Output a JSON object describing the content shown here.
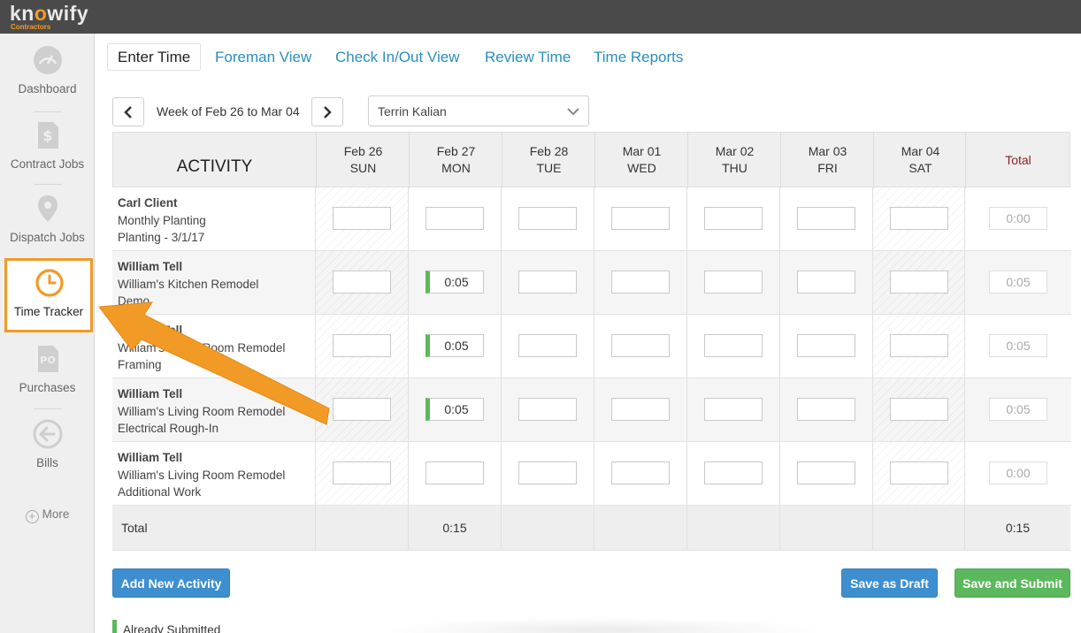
{
  "app": {
    "logo": "knowify",
    "logo_sub": "Contractors"
  },
  "sidebar": {
    "items": [
      {
        "label": "Dashboard",
        "icon": "gauge-icon"
      },
      {
        "label": "Contract Jobs",
        "icon": "dollar-document-icon"
      },
      {
        "label": "Dispatch Jobs",
        "icon": "map-pin-icon"
      },
      {
        "label": "Time Tracker",
        "icon": "clock-icon",
        "active": true
      },
      {
        "label": "Purchases",
        "icon": "po-document-icon"
      },
      {
        "label": "Bills",
        "icon": "arrow-left-circle-icon"
      }
    ],
    "more": "More"
  },
  "tabs": [
    {
      "label": "Enter Time",
      "active": true
    },
    {
      "label": "Foreman View"
    },
    {
      "label": "Check In/Out View"
    },
    {
      "label": "Review Time"
    },
    {
      "label": "Time Reports"
    }
  ],
  "week": {
    "label": "Week of Feb 26 to Mar 04"
  },
  "employee_select": {
    "value": "Terrin Kalian"
  },
  "table": {
    "activity_header": "ACTIVITY",
    "total_header": "Total",
    "days": [
      {
        "date": "Feb 26",
        "weekday": "SUN"
      },
      {
        "date": "Feb 27",
        "weekday": "MON"
      },
      {
        "date": "Feb 28",
        "weekday": "TUE"
      },
      {
        "date": "Mar 01",
        "weekday": "WED"
      },
      {
        "date": "Mar 02",
        "weekday": "THU"
      },
      {
        "date": "Mar 03",
        "weekday": "FRI"
      },
      {
        "date": "Mar 04",
        "weekday": "SAT"
      }
    ],
    "rows": [
      {
        "client": "Carl Client",
        "job": "Monthly Planting",
        "task": "Planting - 3/1/17",
        "values": [
          "",
          "",
          "",
          "",
          "",
          "",
          ""
        ],
        "total": "0:00"
      },
      {
        "client": "William Tell",
        "job": "William's Kitchen Remodel",
        "task": "Demo",
        "values": [
          "",
          "0:05",
          "",
          "",
          "",
          "",
          ""
        ],
        "total": "0:05"
      },
      {
        "client": "William Tell",
        "job": "William's Living Room Remodel",
        "task": "Framing",
        "values": [
          "",
          "0:05",
          "",
          "",
          "",
          "",
          ""
        ],
        "total": "0:05"
      },
      {
        "client": "William Tell",
        "job": "William's Living Room Remodel",
        "task": "Electrical Rough-In",
        "values": [
          "",
          "0:05",
          "",
          "",
          "",
          "",
          ""
        ],
        "total": "0:05"
      },
      {
        "client": "William Tell",
        "job": "William's Living Room Remodel",
        "task": "Additional Work",
        "values": [
          "",
          "",
          "",
          "",
          "",
          "",
          ""
        ],
        "total": "0:00"
      }
    ],
    "totals_label": "Total",
    "day_totals": [
      "",
      "0:15",
      "",
      "",
      "",
      "",
      ""
    ],
    "grand_total": "0:15"
  },
  "buttons": {
    "add_activity": "Add New Activity",
    "save_draft": "Save as Draft",
    "save_submit": "Save and Submit"
  },
  "legend": {
    "submitted": "Already Submitted"
  },
  "colors": {
    "accent_orange": "#f29a26",
    "link_blue": "#2a8dbd",
    "submitted_green": "#5cb85c",
    "button_blue": "#3d8fd0"
  }
}
